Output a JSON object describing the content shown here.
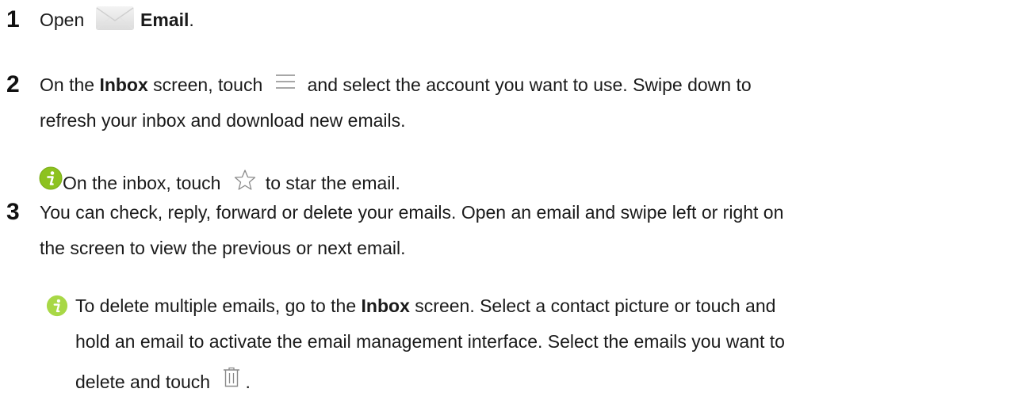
{
  "step1": {
    "number": "1",
    "prefix": "Open",
    "app_name": "Email",
    "suffix": "."
  },
  "step2": {
    "number": "2",
    "line1_a": "On the ",
    "line1_bold": "Inbox",
    "line1_b": " screen, touch",
    "line1_c": "and select the account you want to use. Swipe down to",
    "line2": "refresh your inbox and download new emails."
  },
  "note1": {
    "a": "On the inbox, touch",
    "b": "to star the email."
  },
  "step3": {
    "number": "3",
    "line1": "You can check, reply, forward or delete your emails. Open an email and swipe left or right on",
    "line2": "the screen to view the previous or next email."
  },
  "note2": {
    "line1_a": "To delete multiple emails, go to the ",
    "line1_bold": "Inbox",
    "line1_b": " screen. Select a contact picture or touch and",
    "line2": "hold an email to activate the email management interface. Select the emails you want to",
    "line3_a": "delete and touch",
    "line3_b": "."
  },
  "colors": {
    "info_icon": "#8dc21f",
    "info_icon_light": "#a8d846",
    "line_icon": "#8a8a8a"
  },
  "icons": [
    "email-app-icon",
    "menu-icon",
    "info-icon",
    "star-icon",
    "trash-icon"
  ]
}
